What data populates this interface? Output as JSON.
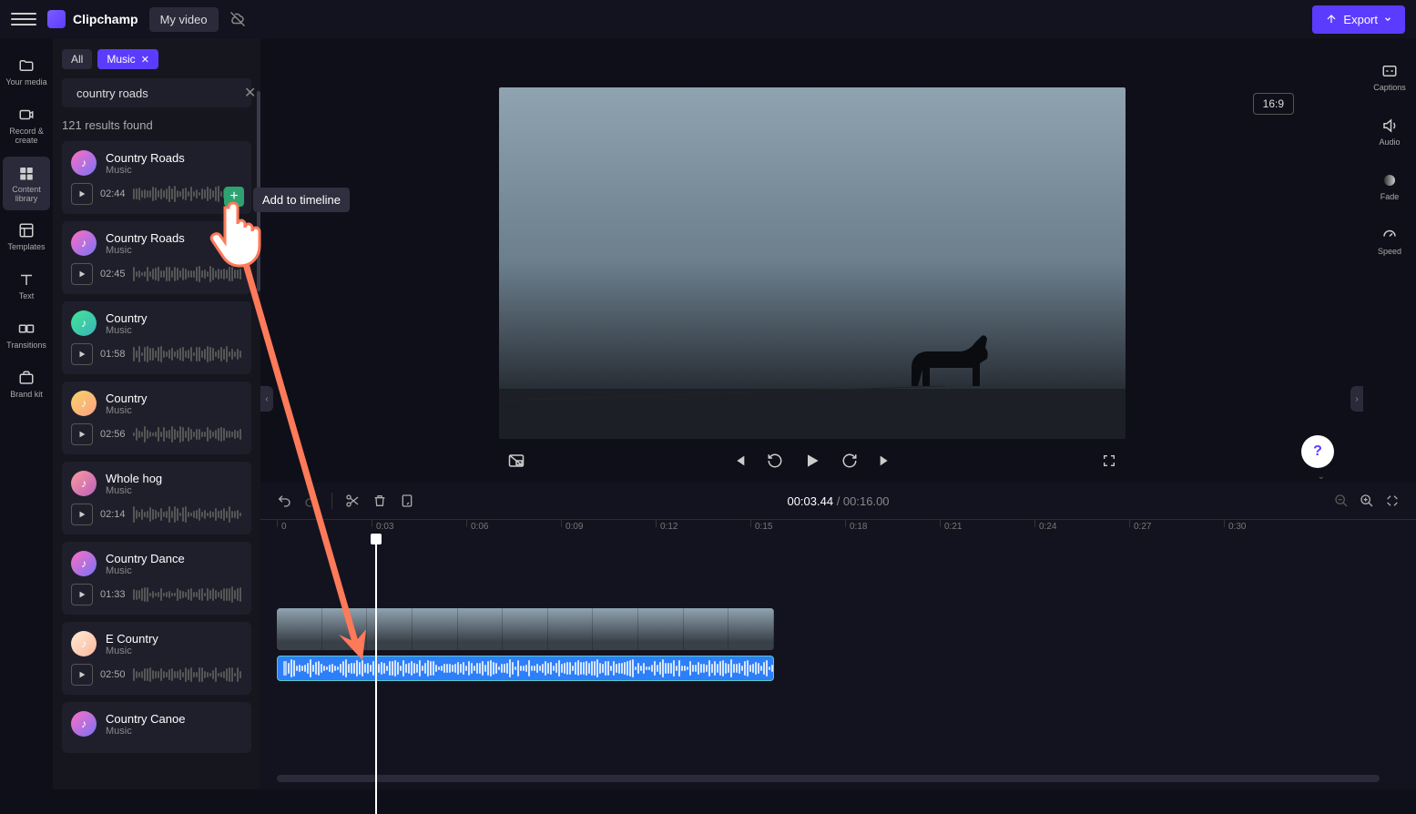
{
  "app": {
    "name": "Clipchamp",
    "project": "My video"
  },
  "export": {
    "label": "Export"
  },
  "leftnav": {
    "items": [
      {
        "label": "Your media"
      },
      {
        "label": "Record & create"
      },
      {
        "label": "Content library"
      },
      {
        "label": "Templates"
      },
      {
        "label": "Text"
      },
      {
        "label": "Transitions"
      },
      {
        "label": "Brand kit"
      }
    ]
  },
  "rightnav": {
    "items": [
      {
        "label": "Captions"
      },
      {
        "label": "Audio"
      },
      {
        "label": "Fade"
      },
      {
        "label": "Speed"
      }
    ]
  },
  "panel": {
    "filter_all": "All",
    "filter_active": "Music",
    "search": {
      "value": "country roads",
      "placeholder": "Search"
    },
    "results": "121 results found",
    "tracks": [
      {
        "title": "Country Roads",
        "sub": "Music",
        "dur": "02:44"
      },
      {
        "title": "Country Roads",
        "sub": "Music",
        "dur": "02:45"
      },
      {
        "title": "Country",
        "sub": "Music",
        "dur": "01:58"
      },
      {
        "title": "Country",
        "sub": "Music",
        "dur": "02:56"
      },
      {
        "title": "Whole hog",
        "sub": "Music",
        "dur": "02:14"
      },
      {
        "title": "Country Dance",
        "sub": "Music",
        "dur": "01:33"
      },
      {
        "title": "E Country",
        "sub": "Music",
        "dur": "02:50"
      },
      {
        "title": "Country Canoe",
        "sub": "Music",
        "dur": ""
      }
    ]
  },
  "tooltip": {
    "text": "Add to timeline"
  },
  "preview": {
    "aspect": "16:9"
  },
  "timeline": {
    "current": "00:03.44",
    "total": "00:16.00",
    "ruler": [
      "0",
      "0:03",
      "0:06",
      "0:09",
      "0:12",
      "0:15",
      "0:18",
      "0:21",
      "0:24",
      "0:27",
      "0:30"
    ]
  },
  "help": {
    "label": "?"
  }
}
